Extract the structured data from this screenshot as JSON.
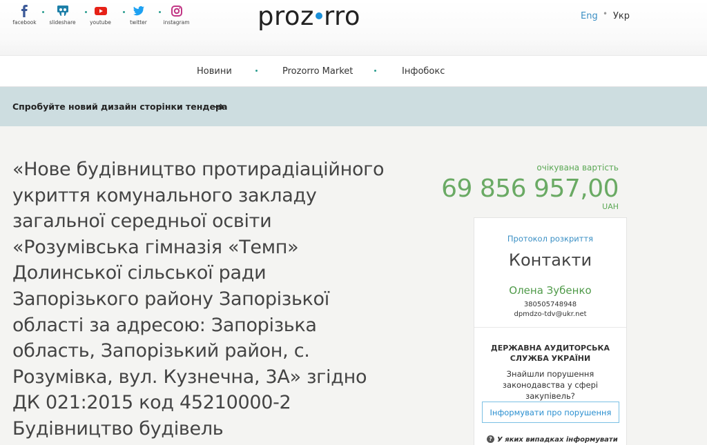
{
  "social": [
    {
      "label": "facebook",
      "icon": "facebook-icon"
    },
    {
      "label": "slideshare",
      "icon": "slideshare-icon"
    },
    {
      "label": "youtube",
      "icon": "youtube-icon"
    },
    {
      "label": "twitter",
      "icon": "twitter-icon"
    },
    {
      "label": "instagram",
      "icon": "instagram-icon"
    }
  ],
  "brand": {
    "left": "proz",
    "right": "rro"
  },
  "lang": {
    "eng": "Eng",
    "ukr": "Укр"
  },
  "nav": [
    "Новини",
    "Prozorro Market",
    "Інфобокс"
  ],
  "banner": {
    "text": "Спробуйте новий дизайн сторінки тендера"
  },
  "tender": {
    "title": "«Нове будівництво протирадіаційного укриття комунального закладу загальної середньої освіти «Розумівська гімназія «Темп» Долинської сільської ради Запорізького району Запорізької області за адресою: Запорізька область, Запорізький район, с. Розумівка, вул. Кузнечна, 3А» згідно ДК 021:2015 код 45210000-2 Будівництво будівель",
    "expected_label": "очікувана вартість",
    "expected_value": "69 856 957,00",
    "currency": "UAH"
  },
  "card": {
    "protocol_link": "Протокол розкриття",
    "contacts_title": "Контакти",
    "contact_name": "Олена Зубенко",
    "phone": "380505748948",
    "email": "dpmdzo-tdv@ukr.net",
    "audit_title": "ДЕРЖАВНА АУДИТОРСЬКА СЛУЖБА УКРАЇНИ",
    "audit_question": "Знайшли порушення законодавства у сфері закупівель?",
    "report_button": "Інформувати про порушення",
    "help_text": "У яких випадках інформувати"
  },
  "colors": {
    "accent_green": "#6aaa64",
    "link_blue": "#3a8fc4",
    "banner_bg": "#cddde0"
  }
}
